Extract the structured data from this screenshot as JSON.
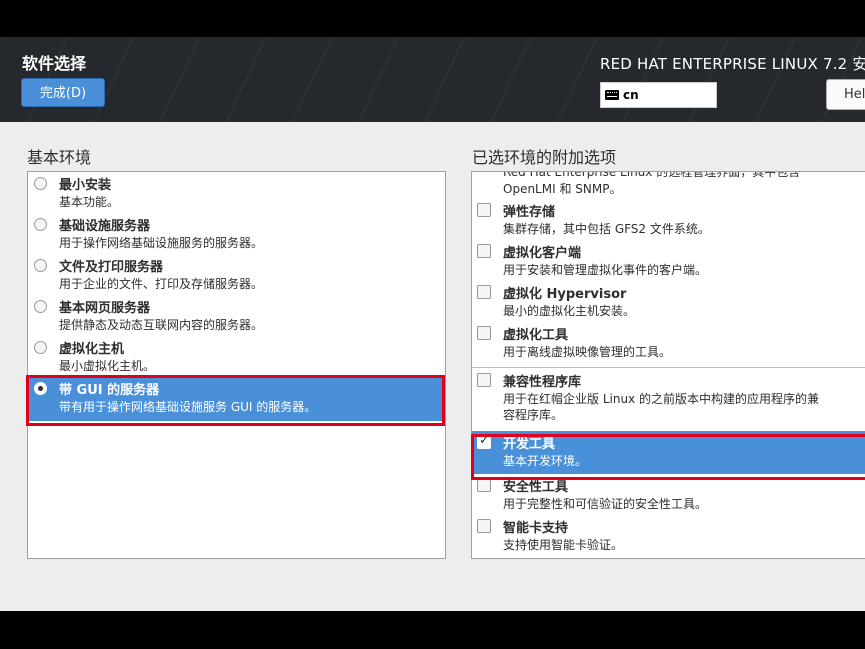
{
  "header": {
    "page_title": "软件选择",
    "done_label": "完成(D)",
    "product": "RED HAT ENTERPRISE LINUX 7.2 安",
    "keyboard_layout": "cn",
    "help_label": "Help!"
  },
  "left": {
    "title": "基本环境",
    "selected_index": 5,
    "items": [
      {
        "label": "最小安装",
        "desc": "基本功能。"
      },
      {
        "label": "基础设施服务器",
        "desc": "用于操作网络基础设施服务的服务器。"
      },
      {
        "label": "文件及打印服务器",
        "desc": "用于企业的文件、打印及存储服务器。"
      },
      {
        "label": "基本网页服务器",
        "desc": "提供静态及动态互联网内容的服务器。"
      },
      {
        "label": "虚拟化主机",
        "desc": "最小虚拟化主机。"
      },
      {
        "label": "带 GUI 的服务器",
        "desc": "带有用于操作网络基础设施服务 GUI 的服务器。"
      }
    ]
  },
  "right": {
    "title": "已选环境的附加选项",
    "cut_top_line1": "Red Hat Enterprise Linux 的远程管理界面，其中包含",
    "cut_top_line2": "OpenLMI 和 SNMP。",
    "items": [
      {
        "label": "弹性存储",
        "desc": "集群存储，其中包括 GFS2 文件系统。",
        "checked": false
      },
      {
        "label": "虚拟化客户端",
        "desc": "用于安装和管理虚拟化事件的客户端。",
        "checked": false
      },
      {
        "label": "虚拟化 Hypervisor",
        "desc": "最小的虚拟化主机安装。",
        "checked": false
      },
      {
        "label": "虚拟化工具",
        "desc": "用于离线虚拟映像管理的工具。",
        "checked": false
      },
      {
        "label": "兼容性程序库",
        "desc": "用于在红帽企业版 Linux 的之前版本中构建的应用程序的兼",
        "desc2": "容程序库。",
        "checked": false
      },
      {
        "label": "开发工具",
        "desc": "基本开发环境。",
        "checked": true
      },
      {
        "label": "安全性工具",
        "desc": "用于完整性和可信验证的安全性工具。",
        "checked": false
      },
      {
        "label": "智能卡支持",
        "desc": "支持使用智能卡验证。",
        "checked": false
      }
    ]
  }
}
